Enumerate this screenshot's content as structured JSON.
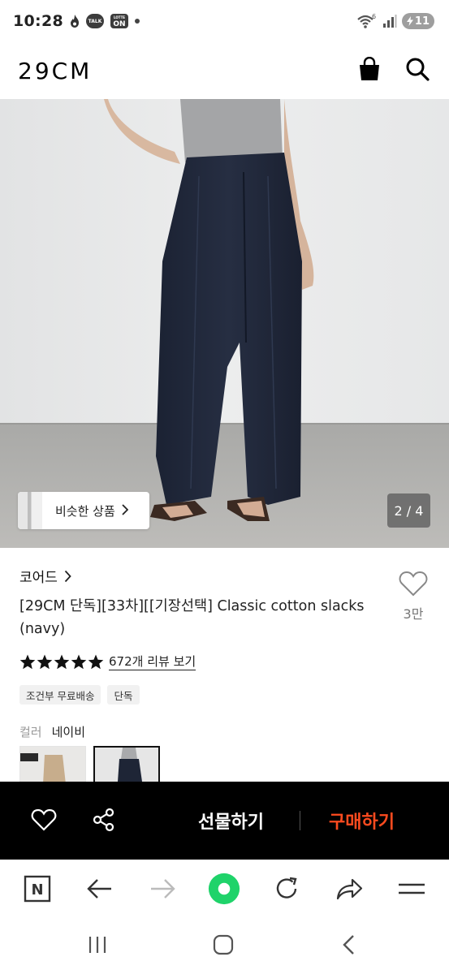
{
  "status_bar": {
    "time": "10:28",
    "badge_talk": "TALK",
    "badge_on": "ON",
    "badge_on_small": "LOTTE",
    "battery": "11",
    "network": "6"
  },
  "header": {
    "logo": "29CM",
    "icons": [
      "shopping-bag-icon",
      "search-icon"
    ]
  },
  "gallery": {
    "similar_label": "비슷한 상품",
    "page_indicator": "2 / 4"
  },
  "product": {
    "brand": "코어드",
    "name": "[29CM 단독][33차][[기장선택] Classic cotton slacks (navy)",
    "wish_count": "3만",
    "rating_stars": 5,
    "review_link": "672개 리뷰 보기",
    "tags": [
      "조건부 무료배송",
      "단독"
    ],
    "color_key": "컬러",
    "color_value": "네이비"
  },
  "action_bar": {
    "gift_label": "선물하기",
    "buy_label": "구매하기",
    "buy_color": "#ff4b1f"
  },
  "browser_bar": {
    "icons": [
      "naver-icon",
      "back-arrow-icon",
      "forward-arrow-icon",
      "home-green-icon",
      "refresh-icon",
      "share-icon",
      "menu-icon"
    ],
    "naver_letter": "N"
  }
}
